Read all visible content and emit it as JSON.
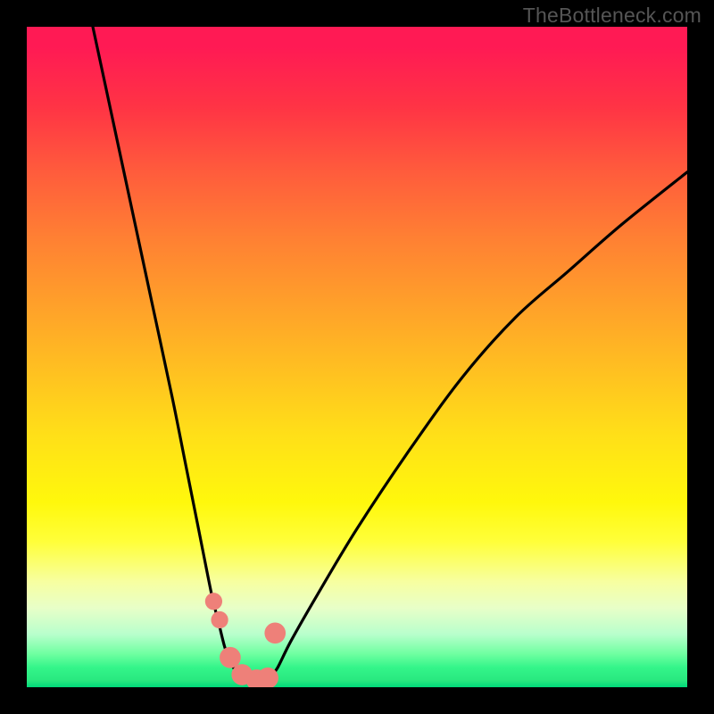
{
  "watermark": "TheBottleneck.com",
  "colors": {
    "frame": "#000000",
    "curve": "#000000",
    "marker_fill": "#ee8079",
    "gradient_top": "#ff1a54",
    "gradient_mid": "#ffe018",
    "gradient_bottom": "#00d97a"
  },
  "chart_data": {
    "type": "line",
    "title": "",
    "xlabel": "",
    "ylabel": "",
    "xlim": [
      0,
      100
    ],
    "ylim": [
      0,
      100
    ],
    "grid": false,
    "legend": false,
    "description": "Bottleneck-style V curve: steep descent from top-left to a flat minimum around x≈30–38, then a shallower rise toward upper right. Six salmon-colored markers cluster near the trough.",
    "series": [
      {
        "name": "curve",
        "x": [
          10,
          13,
          16,
          19,
          22,
          24,
          26,
          28,
          29,
          30,
          31,
          32,
          33,
          34,
          35,
          36,
          37,
          38,
          40,
          44,
          50,
          58,
          66,
          74,
          82,
          90,
          100
        ],
        "y": [
          100,
          86,
          72,
          58,
          44,
          34,
          24,
          14,
          10,
          6,
          3.5,
          2,
          1.3,
          1,
          1,
          1.2,
          1.8,
          3,
          7,
          14,
          24,
          36,
          47,
          56,
          63,
          70,
          78
        ]
      }
    ],
    "markers": {
      "name": "highlight-points",
      "x": [
        28.3,
        29.2,
        30.8,
        32.6,
        34.8,
        36.5,
        37.6
      ],
      "y": [
        13.0,
        10.2,
        4.5,
        1.9,
        1.1,
        1.4,
        8.2
      ],
      "r": [
        1.3,
        1.3,
        1.6,
        1.6,
        1.6,
        1.6,
        1.6
      ]
    }
  }
}
